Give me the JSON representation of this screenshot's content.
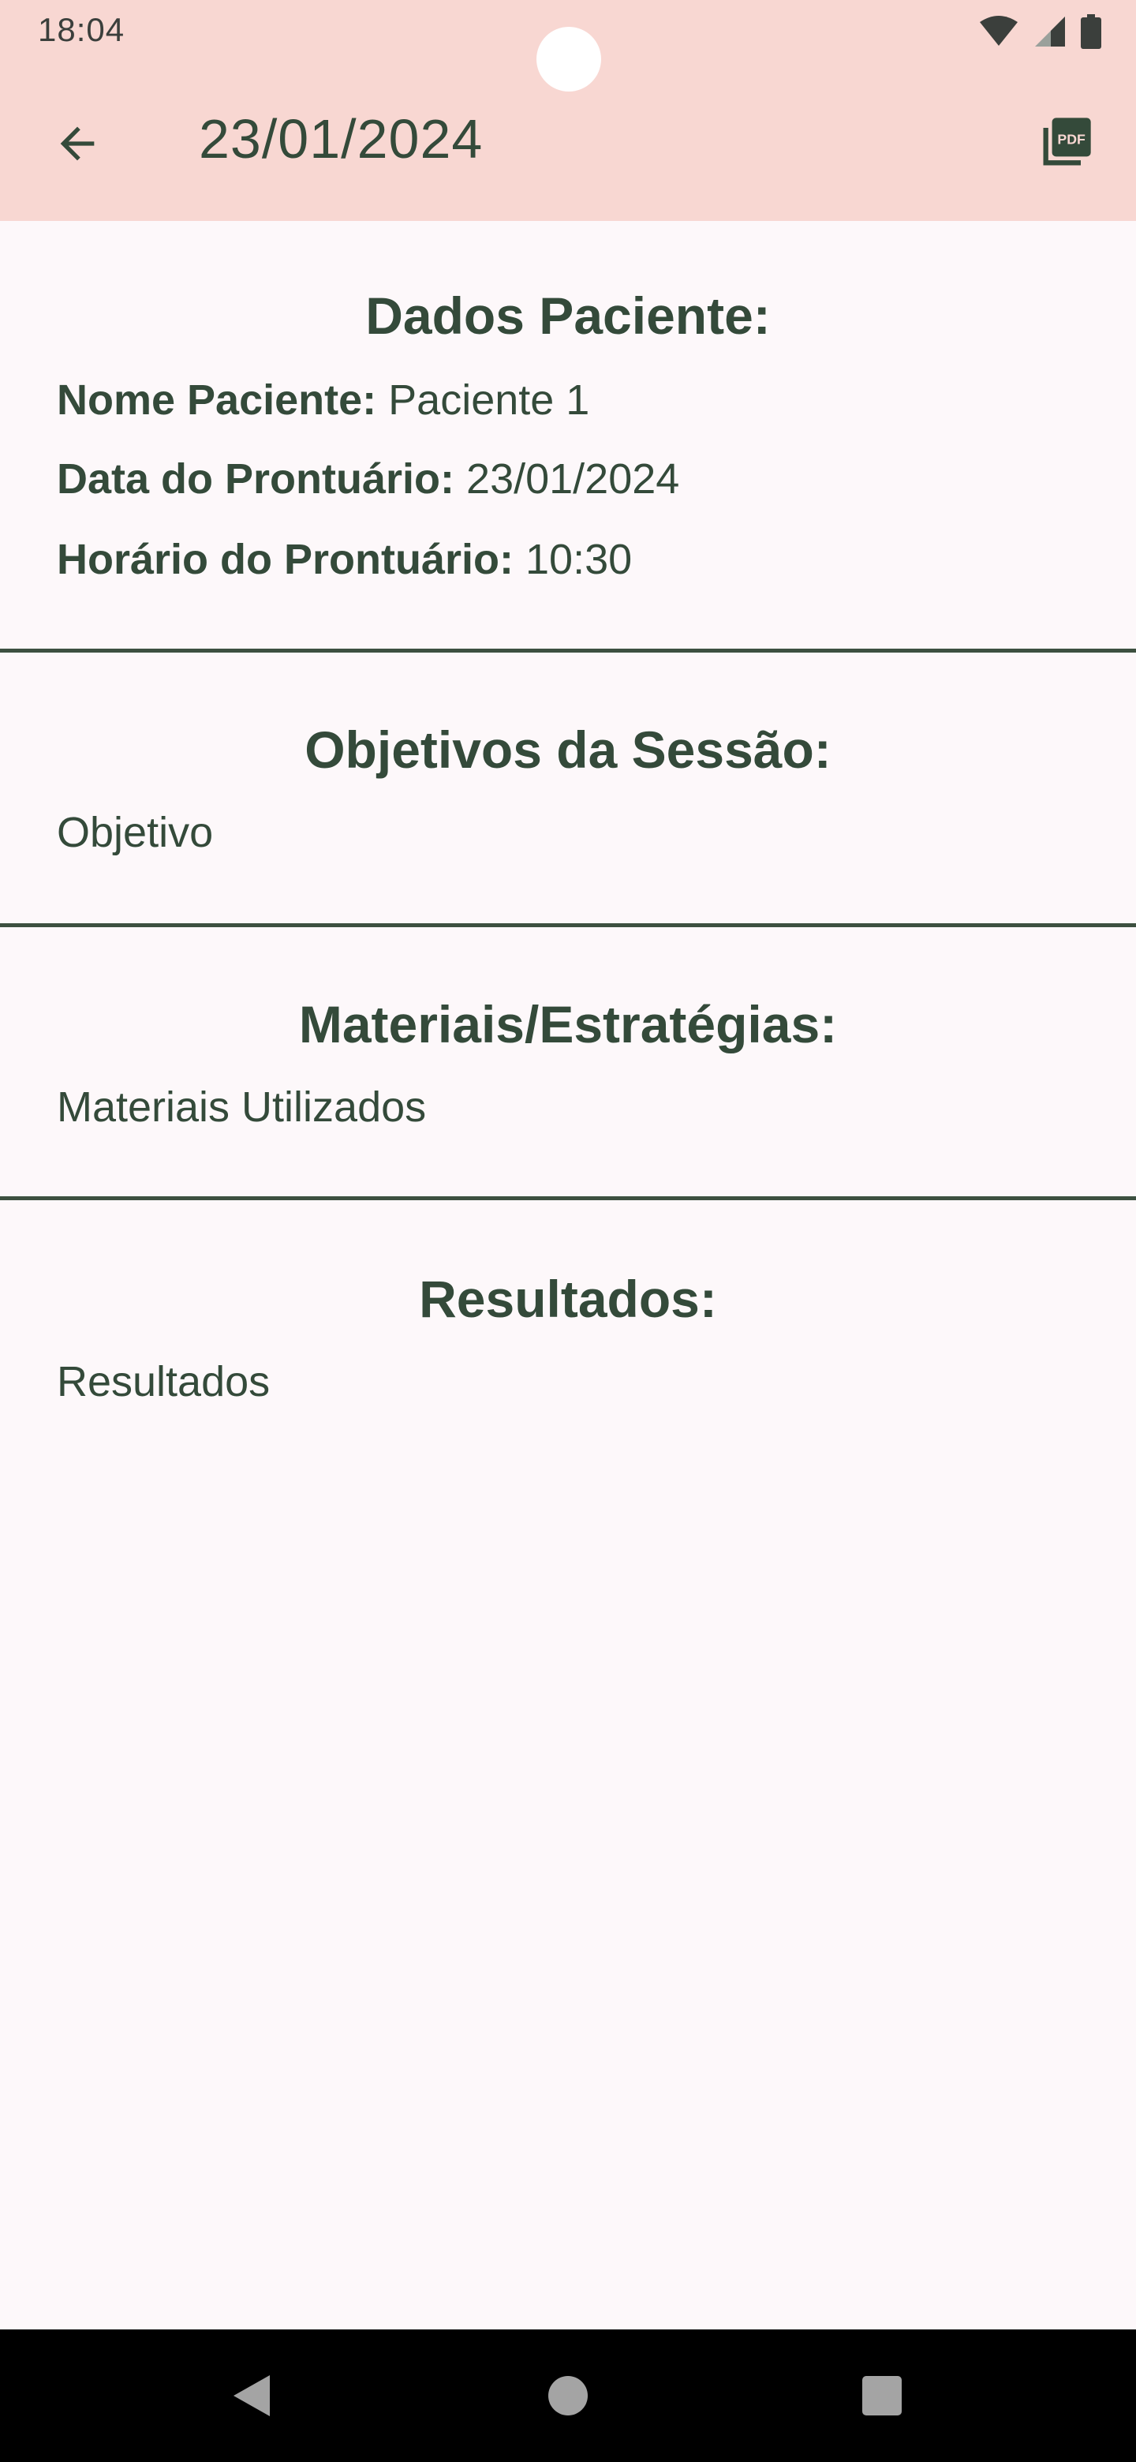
{
  "status_bar": {
    "time": "18:04",
    "icons": [
      "wifi-icon",
      "cellular-signal-icon",
      "battery-icon"
    ]
  },
  "app_bar": {
    "title": "23/01/2024",
    "back_icon": "arrow-back-icon",
    "action_icon": "pdf-icon"
  },
  "patient": {
    "heading": "Dados Paciente:",
    "name_label": "Nome Paciente:",
    "name_value": "Paciente 1",
    "date_label": "Data do Prontuário:",
    "date_value": "23/01/2024",
    "time_label": "Horário do Prontuário:",
    "time_value": "10:30"
  },
  "objectives": {
    "heading": "Objetivos da Sessão:",
    "text": "Objetivo"
  },
  "materials": {
    "heading": "Materiais/Estratégias:",
    "text": "Materiais Utilizados"
  },
  "results": {
    "heading": "Resultados:",
    "text": "Resultados"
  },
  "nav_bar": {
    "icons": [
      "back-triangle-icon",
      "home-circle-icon",
      "recents-square-icon"
    ]
  },
  "colors": {
    "app_bar_bg": "#f8d7d2",
    "page_bg": "#fdf8fa",
    "text": "#344a3a",
    "nav_bar_bg": "#000000"
  }
}
